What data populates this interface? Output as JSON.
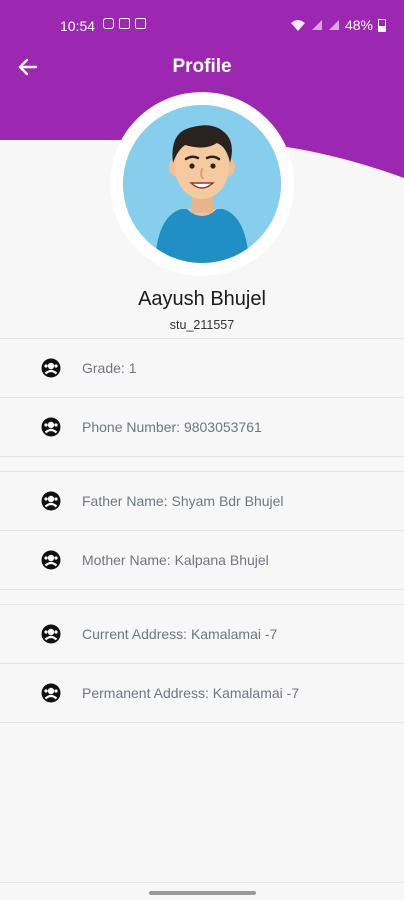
{
  "colors": {
    "accent": "#9c27b0",
    "background": "#f7f7f7",
    "avatar_bg": "#87ceec",
    "row_text": "#6f7780"
  },
  "status_bar": {
    "time": "10:54",
    "left_icons": [
      "instagram-icon",
      "payment-icon",
      "gallery-icon"
    ],
    "right_icons": [
      "wifi-icon",
      "signal-icon",
      "signal-icon",
      "battery-icon"
    ],
    "battery": "48%"
  },
  "header": {
    "title": "Profile",
    "back_icon": "arrow-left-icon"
  },
  "profile": {
    "name": "Aayush Bhujel",
    "username": "stu_211557",
    "avatar_icon": "boy-avatar-icon"
  },
  "details": {
    "row_icon": "person-circle-icon",
    "group1": [
      {
        "label": "Grade: 1"
      },
      {
        "label": "Phone Number: 9803053761"
      }
    ],
    "group2": [
      {
        "label": "Father Name: Shyam Bdr Bhujel"
      },
      {
        "label": "Mother Name: Kalpana Bhujel"
      }
    ],
    "group3": [
      {
        "label": "Current Address: Kamalamai -7"
      },
      {
        "label": "Permanent Address: Kamalamai -7"
      }
    ]
  }
}
